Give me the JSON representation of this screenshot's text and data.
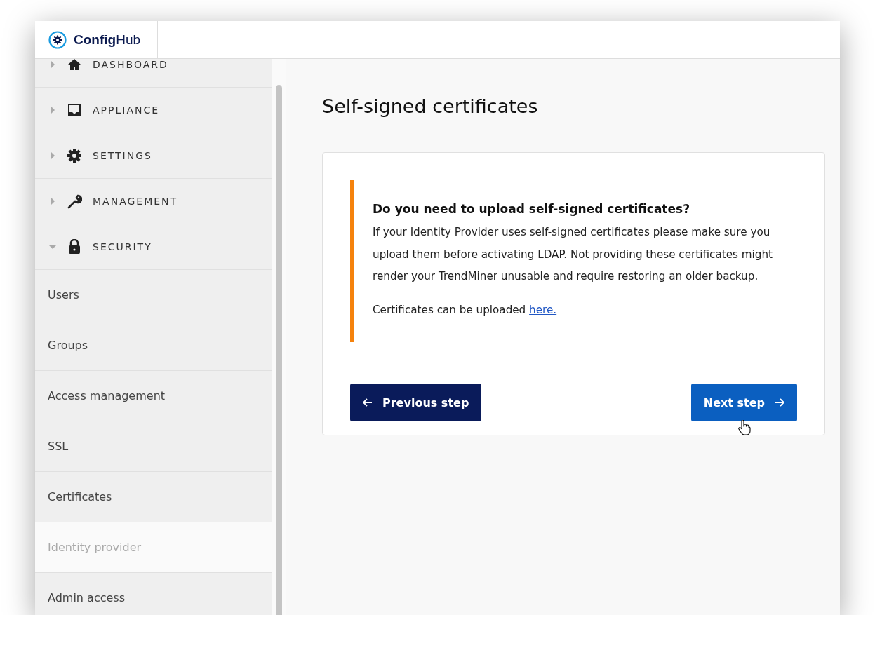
{
  "header": {
    "logo": "**Config**Hub"
  },
  "sidebar": {
    "sections": [
      {
        "label": "DASHBOARD",
        "expanded": false
      },
      {
        "label": "APPLIANCE",
        "expanded": false
      },
      {
        "label": "SETTINGS",
        "expanded": false
      },
      {
        "label": "MANAGEMENT",
        "expanded": false
      },
      {
        "label": "SECURITY",
        "expanded": true,
        "children": [
          {
            "label": "Users",
            "selected": false
          },
          {
            "label": "Groups",
            "selected": false
          },
          {
            "label": "Access management",
            "selected": false
          },
          {
            "label": "SSL",
            "selected": false
          },
          {
            "label": "Certificates",
            "selected": false
          },
          {
            "label": "Identity provider",
            "selected": true
          },
          {
            "label": "Admin access",
            "selected": false
          }
        ]
      }
    ]
  },
  "page": {
    "title": "Self-signed certificates"
  },
  "notice": {
    "heading": "Do you need to upload self-signed certificates?",
    "body": "If your Identity Provider uses self-signed certificates please make sure you upload them before activating LDAP. Not providing these certificates might render your TrendMiner unusable and require restoring an older backup.",
    "link_prefix": "Certificates can be uploaded",
    "link": "here."
  },
  "buttons": [
    {
      "label": "Previous step",
      "kind": "previous",
      "hovered": false
    },
    {
      "label": "Next step",
      "kind": "next",
      "hovered": true
    }
  ]
}
